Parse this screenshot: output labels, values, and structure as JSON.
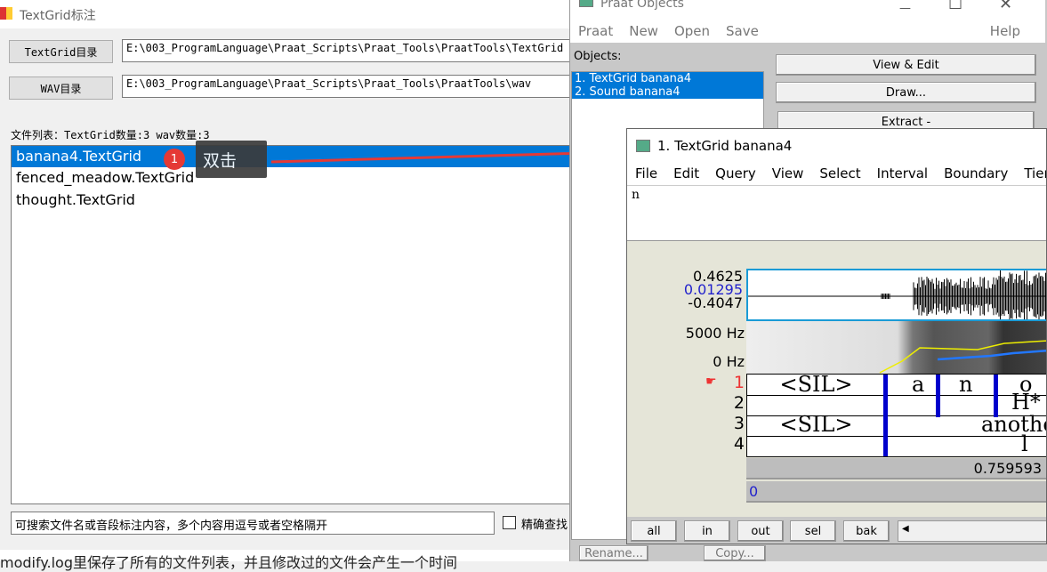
{
  "app": {
    "title": "TextGrid标注",
    "textgrid_dir_button": "TextGrid目录",
    "textgrid_dir_value": "E:\\003_ProgramLanguage\\Praat_Scripts\\Praat_Tools\\PraatTools\\TextGrid",
    "wav_dir_button": "WAV目录",
    "wav_dir_value": "E:\\003_ProgramLanguage\\Praat_Scripts\\Praat_Tools\\PraatTools\\wav",
    "file_list_label": "文件列表：TextGrid数量:3 wav数量:3",
    "files": [
      "banana4.TextGrid",
      "fenced_meadow.TextGrid",
      "thought.TextGrid"
    ],
    "search_placeholder": "可搜索文件名或音段标注内容，多个内容用逗号或者空格隔开",
    "exact_search_label": "精确查找",
    "footer_note": "modify.log里保存了所有的文件列表，并且修改过的文件会产生一个时间"
  },
  "annotation": {
    "step": "1",
    "text": "双击",
    "accent": "#e53935"
  },
  "praat_objects": {
    "title": "Praat Objects",
    "menu": [
      "Praat",
      "New",
      "Open",
      "Save"
    ],
    "help": "Help",
    "objects_label": "Objects:",
    "objects": [
      "1. TextGrid banana4",
      "2. Sound banana4"
    ],
    "buttons": [
      "View & Edit",
      "Draw...",
      "Extract -"
    ],
    "bottom_buttons": [
      "Rename...",
      "Copy..."
    ]
  },
  "editor": {
    "title": "1. TextGrid banana4",
    "menu": [
      "File",
      "Edit",
      "Query",
      "View",
      "Select",
      "Interval",
      "Boundary",
      "Tier"
    ],
    "text_value": "n",
    "wave_max": "0.4625",
    "wave_cursor": "0.01295",
    "wave_min": "-0.4047",
    "spec_max": "5000 Hz",
    "spec_min": "0 Hz",
    "tiers": [
      "1",
      "2",
      "3",
      "4"
    ],
    "tier1": [
      "<SIL>",
      "a",
      "n",
      "o"
    ],
    "tier2": [
      "H*"
    ],
    "tier3": [
      "<SIL>",
      "anothe"
    ],
    "tier4": [
      "l"
    ],
    "time_window": "0.759593",
    "time_start": "0",
    "nav_buttons": [
      "all",
      "in",
      "out",
      "sel",
      "bak"
    ]
  }
}
